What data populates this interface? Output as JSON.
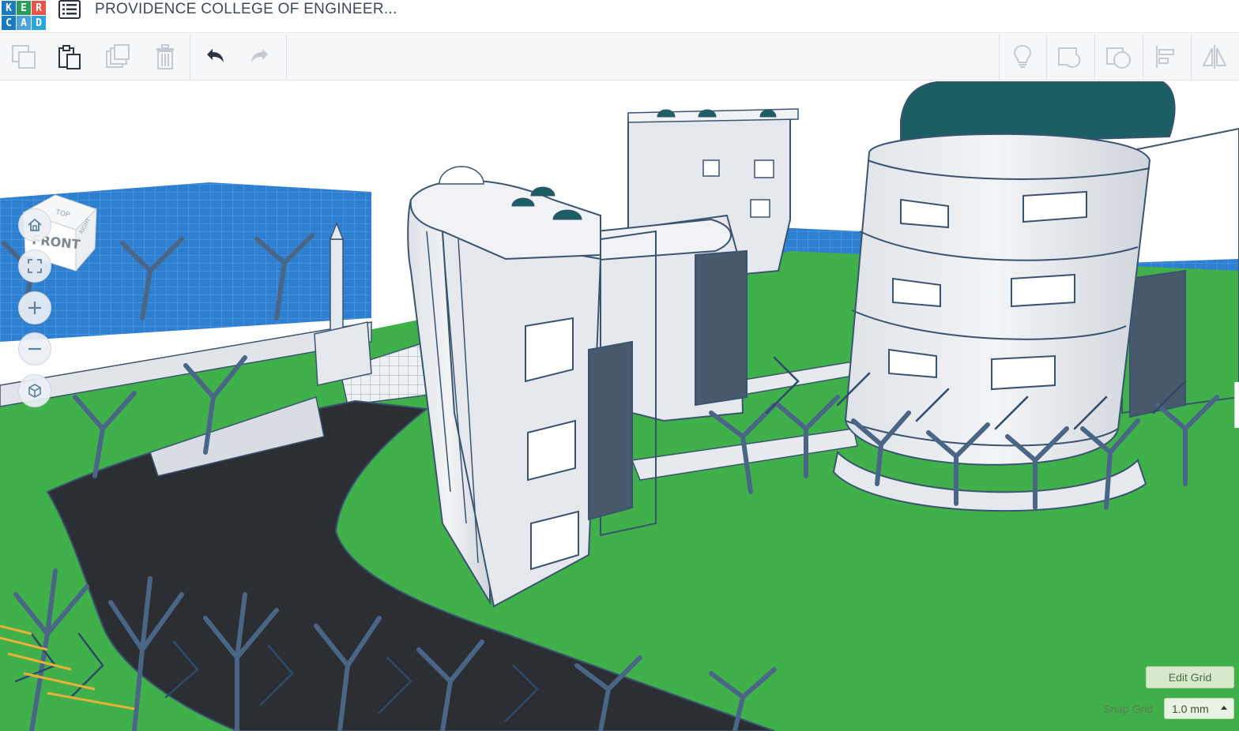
{
  "app": {
    "logo_letters": [
      "K",
      "E",
      "R",
      "C",
      "A",
      "D"
    ],
    "logo_colors": [
      "#1a7bc0",
      "#2a9d58",
      "#e9544a",
      "#1a7bc0",
      "#4aa3df",
      "#2aa7d8"
    ],
    "design_title": "PROVIDENCE COLLEGE OF ENGINEER..."
  },
  "toolbar": {
    "left": [
      {
        "name": "copy-button",
        "icon": "copy-icon",
        "enabled": false
      },
      {
        "name": "paste-button",
        "icon": "paste-icon",
        "enabled": true
      },
      {
        "name": "duplicate-button",
        "icon": "duplicate-icon",
        "enabled": false
      },
      {
        "name": "delete-button",
        "icon": "trash-icon",
        "enabled": false
      },
      {
        "name": "undo-button",
        "icon": "undo-icon",
        "enabled": true
      },
      {
        "name": "redo-button",
        "icon": "redo-icon",
        "enabled": false
      }
    ],
    "right": [
      {
        "name": "toggle-visible-button",
        "icon": "lightbulb-icon",
        "enabled": false
      },
      {
        "name": "group-button",
        "icon": "group-icon",
        "enabled": false
      },
      {
        "name": "ungroup-button",
        "icon": "ungroup-icon",
        "enabled": false
      },
      {
        "name": "align-button",
        "icon": "align-icon",
        "enabled": false
      },
      {
        "name": "mirror-button",
        "icon": "mirror-icon",
        "enabled": false
      }
    ]
  },
  "viewcube": {
    "top_label": "TOP",
    "front_label": "FRONT",
    "side_label": "RIGHT"
  },
  "nav_controls": [
    {
      "name": "home-view-button",
      "icon": "home-icon"
    },
    {
      "name": "fit-all-button",
      "icon": "fit-view-icon"
    },
    {
      "name": "zoom-in-button",
      "icon": "plus-icon"
    },
    {
      "name": "zoom-out-button",
      "icon": "minus-icon"
    },
    {
      "name": "projection-toggle-button",
      "icon": "cube-icon"
    }
  ],
  "grid": {
    "edit_grid_label": "Edit Grid",
    "snap_grid_label": "Snap Grid",
    "snap_value": "1.0 mm"
  },
  "colors": {
    "ground": "#3fb04a",
    "water": "#2f7fd0",
    "road": "#2b2f33",
    "building": "#e5e8ec",
    "outline": "#3a5470",
    "dome": "#1b5e63"
  }
}
